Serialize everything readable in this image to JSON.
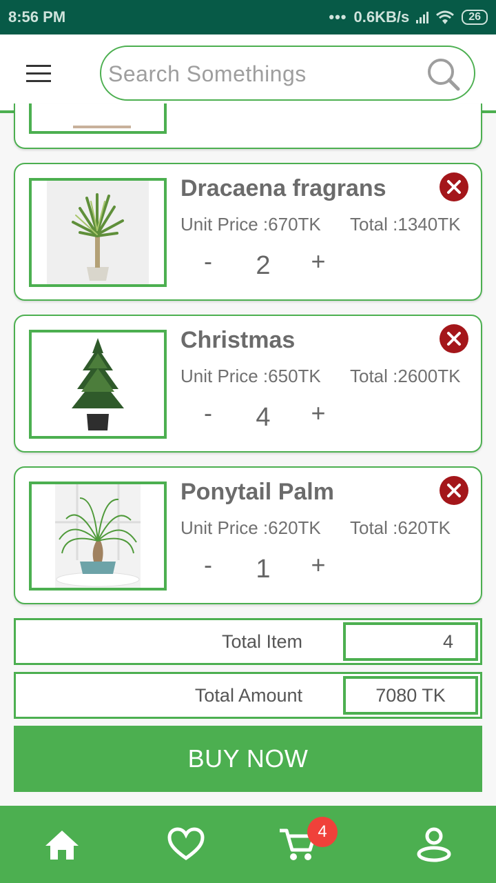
{
  "status_bar": {
    "time": "8:56 PM",
    "dots": "•••",
    "network_speed": "0.6KB/s",
    "battery": "26"
  },
  "search": {
    "placeholder": "Search Somethings"
  },
  "cart_items": [
    {
      "name": "Dracaena fragrans",
      "unit_price": "Unit Price :670TK",
      "total": "Total :1340TK",
      "minus": "-",
      "quantity": "2",
      "plus": "+"
    },
    {
      "name": "Christmas",
      "unit_price": "Unit Price :650TK",
      "total": "Total :2600TK",
      "minus": "-",
      "quantity": "4",
      "plus": "+"
    },
    {
      "name": "Ponytail Palm",
      "unit_price": "Unit Price :620TK",
      "total": "Total :620TK",
      "minus": "-",
      "quantity": "1",
      "plus": "+"
    }
  ],
  "summary": {
    "total_item_label": "Total Item",
    "total_item_value": "4",
    "total_amount_label": "Total Amount",
    "total_amount_value": "7080 TK"
  },
  "buy_button": "BUY NOW",
  "bottom_nav": {
    "items": [
      "home-icon",
      "heart-icon",
      "cart-icon",
      "profile-icon"
    ],
    "cart_badge": "4"
  },
  "colors": {
    "accent": "#4caf50",
    "status_bar": "#075a47",
    "remove": "#a4161a",
    "badge": "#f0413a"
  }
}
